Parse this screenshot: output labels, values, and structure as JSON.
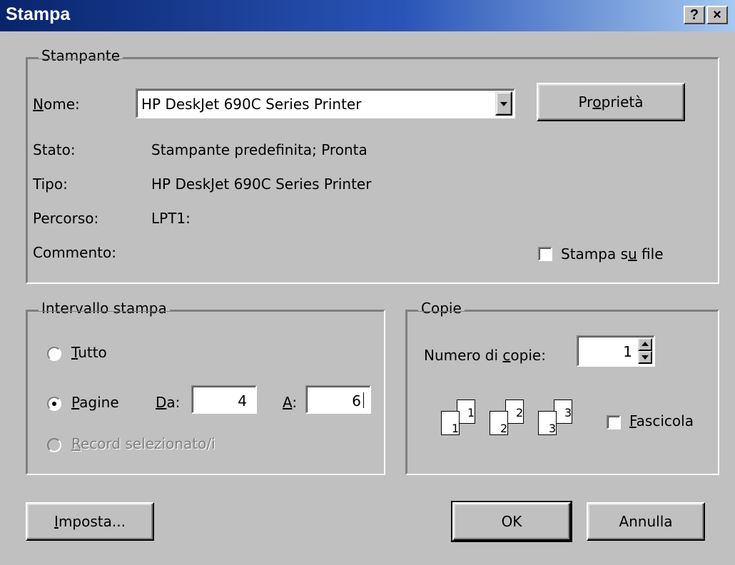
{
  "window": {
    "title": "Stampa",
    "help_glyph": "?",
    "close_glyph": "×"
  },
  "printer": {
    "legend": "Stampante",
    "name_label_u": "N",
    "name_label_rest": "ome:",
    "name_value": "HP DeskJet 690C Series Printer",
    "props_pre": "Pr",
    "props_u": "o",
    "props_post": "prietà",
    "status_label": "Stato:",
    "status_value": "Stampante predefinita; Pronta",
    "type_label": "Tipo:",
    "type_value": "HP DeskJet 690C Series Printer",
    "path_label": "Percorso:",
    "path_value": "LPT1:",
    "comment_label": "Commento:",
    "print_to_file_pre": "Stampa s",
    "print_to_file_u": "u",
    "print_to_file_post": " file",
    "print_to_file_checked": false
  },
  "range": {
    "legend": "Intervallo stampa",
    "all_u": "T",
    "all_rest": "utto",
    "pages_u": "P",
    "pages_rest": "agine",
    "from_u": "D",
    "from_rest": "a:",
    "from_value": "4",
    "to_u": "A",
    "to_rest": ":",
    "to_value": "6",
    "selection_u": "R",
    "selection_rest": "ecord selezionato/i",
    "selected": "pages"
  },
  "copies": {
    "legend": "Copie",
    "num_pre": "Numero di ",
    "num_u": "c",
    "num_post": "opie:",
    "num_value": "1",
    "collate_u": "F",
    "collate_rest": "ascicola",
    "collate_checked": false,
    "page_icons": [
      {
        "front": "1",
        "back": "1"
      },
      {
        "front": "2",
        "back": "2"
      },
      {
        "front": "3",
        "back": "3"
      }
    ]
  },
  "buttons": {
    "setup_u": "I",
    "setup_rest": "mposta...",
    "ok": "OK",
    "cancel": "Annulla"
  }
}
